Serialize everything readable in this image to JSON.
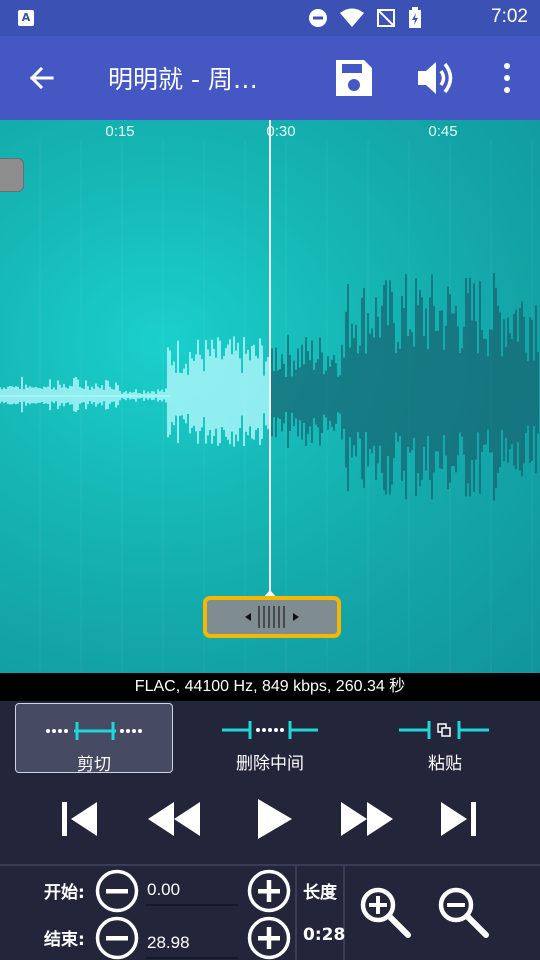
{
  "status_bar": {
    "app_icon_letter": "A",
    "time": "7:02",
    "icons": [
      "dnd-icon",
      "wifi-icon",
      "no-signal-icon",
      "battery-charging-icon"
    ]
  },
  "toolbar": {
    "title": "明明就 - 周…",
    "icons": [
      "back-arrow-icon",
      "save-icon",
      "volume-icon",
      "more-vert-icon"
    ]
  },
  "waveform": {
    "time_ticks": [
      "0:15",
      "0:30",
      "0:45"
    ],
    "colors": {
      "played": "#b8fbff",
      "unplayed": "#17606e",
      "background": "#16b8b6"
    }
  },
  "info_line": "FLAC, 44100 Hz, 849 kbps, 260.34 秒",
  "modes": [
    {
      "label": "剪切",
      "active": true
    },
    {
      "label": "删除中间",
      "active": false
    },
    {
      "label": "粘贴",
      "active": false
    }
  ],
  "transport": [
    "skip-start-icon",
    "rewind-icon",
    "play-icon",
    "fast-forward-icon",
    "skip-end-icon"
  ],
  "trim": {
    "start_label": "开始:",
    "start_value": "0.00",
    "end_label": "结束:",
    "end_value": "28.98",
    "length_label": "长度",
    "length_value": "0:28"
  },
  "accent_color": "#1ed8d8",
  "highlight_color": "#f5b800"
}
